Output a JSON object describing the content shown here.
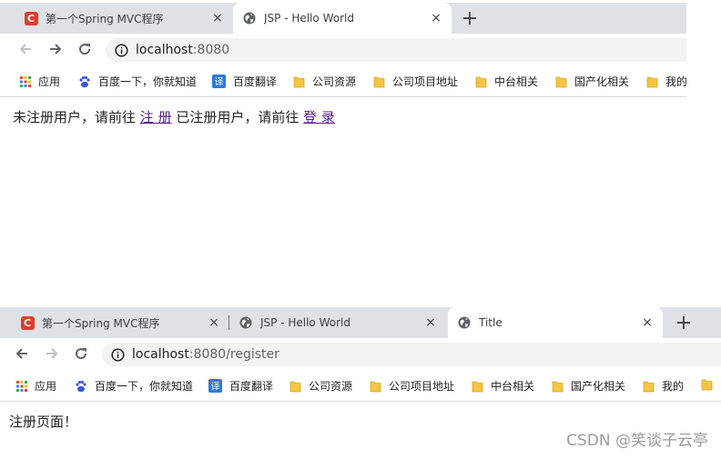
{
  "screens": [
    {
      "tabs": [
        {
          "title": "第一个Spring MVC程序",
          "icon": "csdn-c-icon",
          "close": "×"
        },
        {
          "title": "JSP - Hello World",
          "icon": "globe-icon",
          "close": "×"
        }
      ],
      "new_tab": "+",
      "url": {
        "host": "localhost",
        "rest": ":8080"
      },
      "bookmarks": [
        "应用",
        "百度一下，你就知道",
        "百度翻译",
        "公司资源",
        "公司项目地址",
        "中台相关",
        "国产化相关",
        "我的"
      ],
      "content": {
        "text1": "未注册用户，请前往",
        "link1": "注 册",
        "text2": "已注册用户，请前往",
        "link2": "登 录"
      }
    },
    {
      "tabs": [
        {
          "title": "第一个Spring MVC程序",
          "icon": "csdn-c-icon",
          "close": "×"
        },
        {
          "title": "JSP - Hello World",
          "icon": "globe-icon",
          "close": "×"
        },
        {
          "title": "Title",
          "icon": "globe-icon",
          "close": "×"
        }
      ],
      "new_tab": "+",
      "url": {
        "host": "localhost",
        "rest": ":8080/register"
      },
      "bookmarks": [
        "应用",
        "百度一下，你就知道",
        "百度翻译",
        "公司资源",
        "公司项目地址",
        "中台相关",
        "国产化相关",
        "我的"
      ],
      "content": {
        "text": "注册页面！"
      }
    }
  ],
  "watermark": "CSDN @笑谈子云亭",
  "colors": {
    "tabbar": "#dee1e6",
    "link": "#551a8b",
    "folder": "#f4c542",
    "csdn": "#e03c2c",
    "baidu": "#3a5bd9",
    "translate": "#2a7ae2"
  }
}
